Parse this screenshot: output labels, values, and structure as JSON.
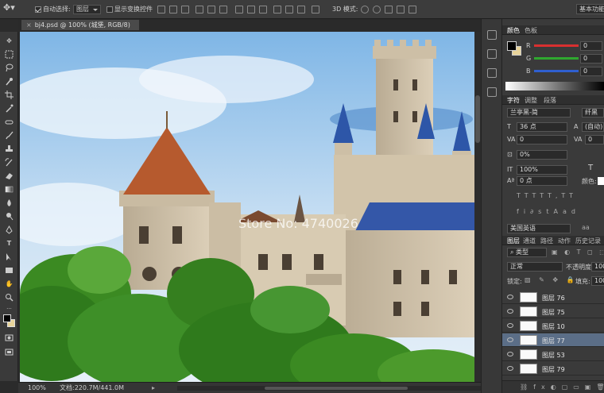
{
  "options_bar": {
    "auto_select_label": "自动选择:",
    "auto_select_value": "图层",
    "show_transform_label": "显示变换控件",
    "mode_3d_label": "3D 模式:",
    "workspace": "基本功能"
  },
  "document": {
    "tab_title": "bj4.psd @ 100% (城堡, RGB/8)",
    "watermark": "Store No: 4740026"
  },
  "status": {
    "zoom": "100%",
    "doc_size": "文档:220.7M/441.0M"
  },
  "color_panel": {
    "tabs": [
      "颜色",
      "色板"
    ],
    "r_label": "R",
    "g_label": "G",
    "b_label": "B",
    "r_value": "0",
    "g_value": "0",
    "b_value": "0"
  },
  "character_panel": {
    "tabs": [
      "字符",
      "调整",
      "段落"
    ],
    "font_family": "兰亭黑-简",
    "font_style": "纤黑",
    "font_size": "36 点",
    "leading": "(自动)",
    "kerning": "0",
    "tracking": "0",
    "scale_percent": "0%",
    "vertical_scale": "100%",
    "baseline": "0 点",
    "color_label": "颜色:",
    "language": "美国英语"
  },
  "layers_panel": {
    "tabs": [
      "图层",
      "通道",
      "路径",
      "动作",
      "历史记录"
    ],
    "filter": "类型",
    "blend_mode": "正常",
    "opacity_label": "不透明度:",
    "opacity_value": "100",
    "lock_label": "锁定:",
    "fill_label": "填充:",
    "fill_value": "100",
    "layers": [
      {
        "name": "图层 76"
      },
      {
        "name": "图层 75"
      },
      {
        "name": "图层 10"
      },
      {
        "name": "图层 77"
      },
      {
        "name": "图层 53"
      },
      {
        "name": "图层 79"
      }
    ]
  },
  "colors": {
    "accent_selected": "#5b6e87",
    "slider_r": "#d93030",
    "slider_g": "#2fa82f",
    "slider_b": "#2f5fd0"
  }
}
